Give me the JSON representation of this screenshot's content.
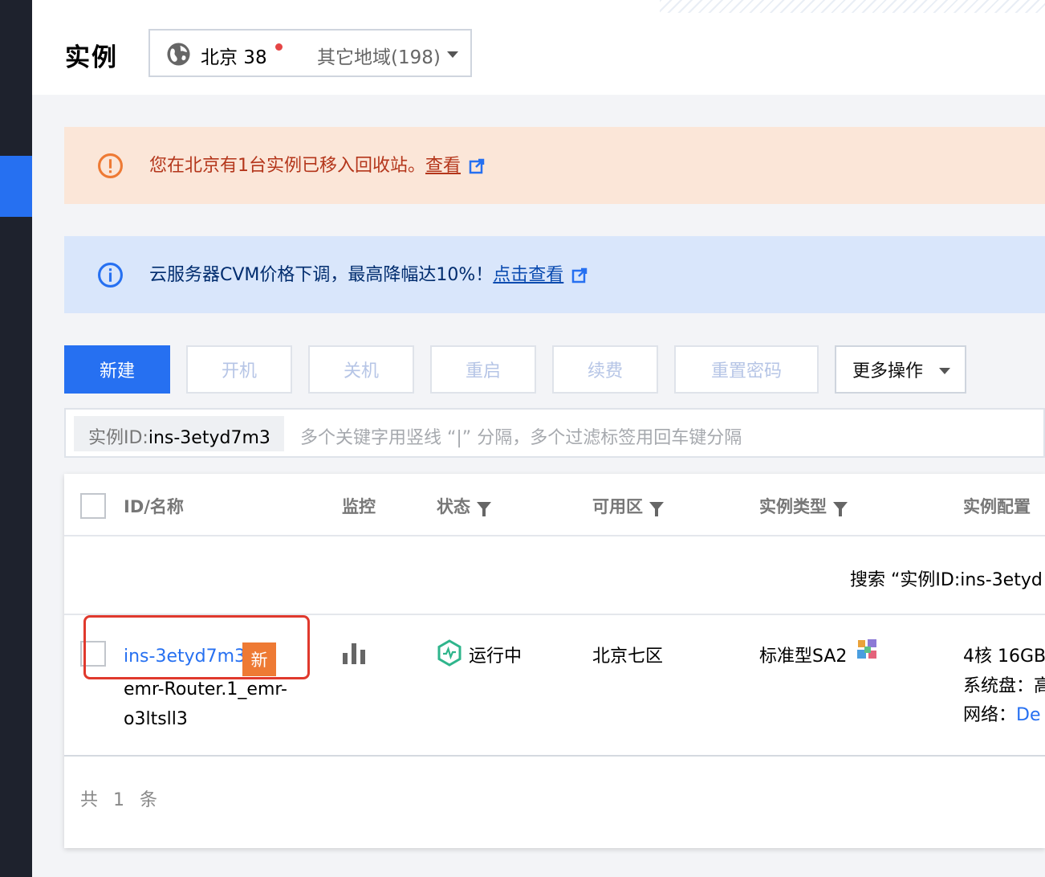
{
  "header": {
    "title": "实例",
    "region_current": "北京 38",
    "region_other": "其它地域(198)"
  },
  "alerts": {
    "recycle": {
      "text": "您在北京有1台实例已移入回收站。",
      "link": "查看"
    },
    "price": {
      "text": "云服务器CVM价格下调，最高降幅达10%！",
      "link": "点击查看"
    }
  },
  "toolbar": {
    "new": "新建",
    "start": "开机",
    "stop": "关机",
    "restart": "重启",
    "renew": "续费",
    "reset_password": "重置密码",
    "more": "更多操作"
  },
  "search": {
    "tag_key": "实例ID:",
    "tag_value": "ins-3etyd7m3",
    "placeholder": "多个关键字用竖线 “|” 分隔，多个过滤标签用回车键分隔"
  },
  "table": {
    "columns": {
      "id_name": "ID/名称",
      "monitor": "监控",
      "status": "状态",
      "zone": "可用区",
      "type": "实例类型",
      "config": "实例配置"
    },
    "search_notice": "搜索 “实例ID:ins-3etyd",
    "rows": [
      {
        "id": "ins-3etyd7m3",
        "badge": "新",
        "name_line1": "emr-Router.1_emr-",
        "name_line2": "o3ltsll3",
        "status": "运行中",
        "zone": "北京七区",
        "type": "标准型SA2",
        "config_line1": "4核 16GB",
        "config_line2_label": "系统盘：",
        "config_line2_value": "高",
        "config_line3_label": "网络：",
        "config_line3_value": "De"
      }
    ],
    "total": "共 1 条"
  },
  "colors": {
    "primary": "#2670f1",
    "warn_bg": "#fbe6d8",
    "info_bg": "#d9e6fb",
    "badge": "#ee7a34",
    "highlight": "#e0392d",
    "status_green": "#2fb58c"
  }
}
